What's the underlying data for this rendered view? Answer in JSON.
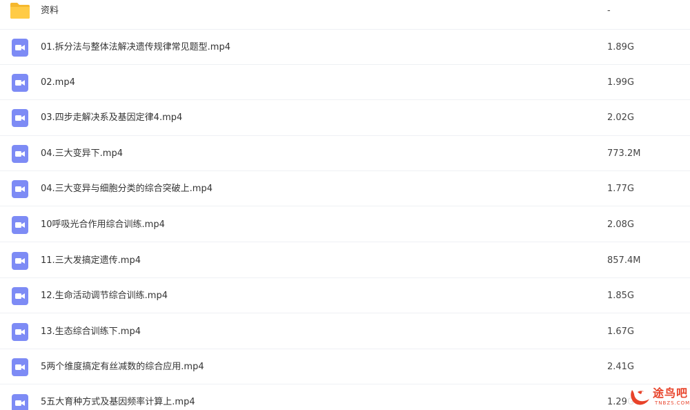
{
  "colors": {
    "folder": "#ffcb45",
    "video_icon": "#7d8bf5",
    "watermark": "#e8432a"
  },
  "files": [
    {
      "icon": "folder-icon",
      "name": "资料",
      "size": "-"
    },
    {
      "icon": "video-file-icon",
      "name": "01.拆分法与整体法解决遗传规律常见题型.mp4",
      "size": "1.89G"
    },
    {
      "icon": "video-file-icon",
      "name": "02.mp4",
      "size": "1.99G"
    },
    {
      "icon": "video-file-icon",
      "name": "03.四步走解决系及基因定律4.mp4",
      "size": "2.02G"
    },
    {
      "icon": "video-file-icon",
      "name": "04.三大变异下.mp4",
      "size": "773.2M"
    },
    {
      "icon": "video-file-icon",
      "name": "04.三大变异与细胞分类的综合突破上.mp4",
      "size": "1.77G"
    },
    {
      "icon": "video-file-icon",
      "name": "10呼吸光合作用综合训练.mp4",
      "size": "2.08G"
    },
    {
      "icon": "video-file-icon",
      "name": "11.三大发搞定遗传.mp4",
      "size": "857.4M"
    },
    {
      "icon": "video-file-icon",
      "name": "12.生命活动调节综合训练.mp4",
      "size": "1.85G"
    },
    {
      "icon": "video-file-icon",
      "name": "13.生态综合训练下.mp4",
      "size": "1.67G"
    },
    {
      "icon": "video-file-icon",
      "name": "5两个维度搞定有丝减数的综合应用.mp4",
      "size": "2.41G"
    },
    {
      "icon": "video-file-icon",
      "name": "5五大育种方式及基因频率计算上.mp4",
      "size": "1.29G"
    }
  ],
  "watermark": {
    "text": "途鸟吧",
    "sub": "TNBZS.COM"
  }
}
